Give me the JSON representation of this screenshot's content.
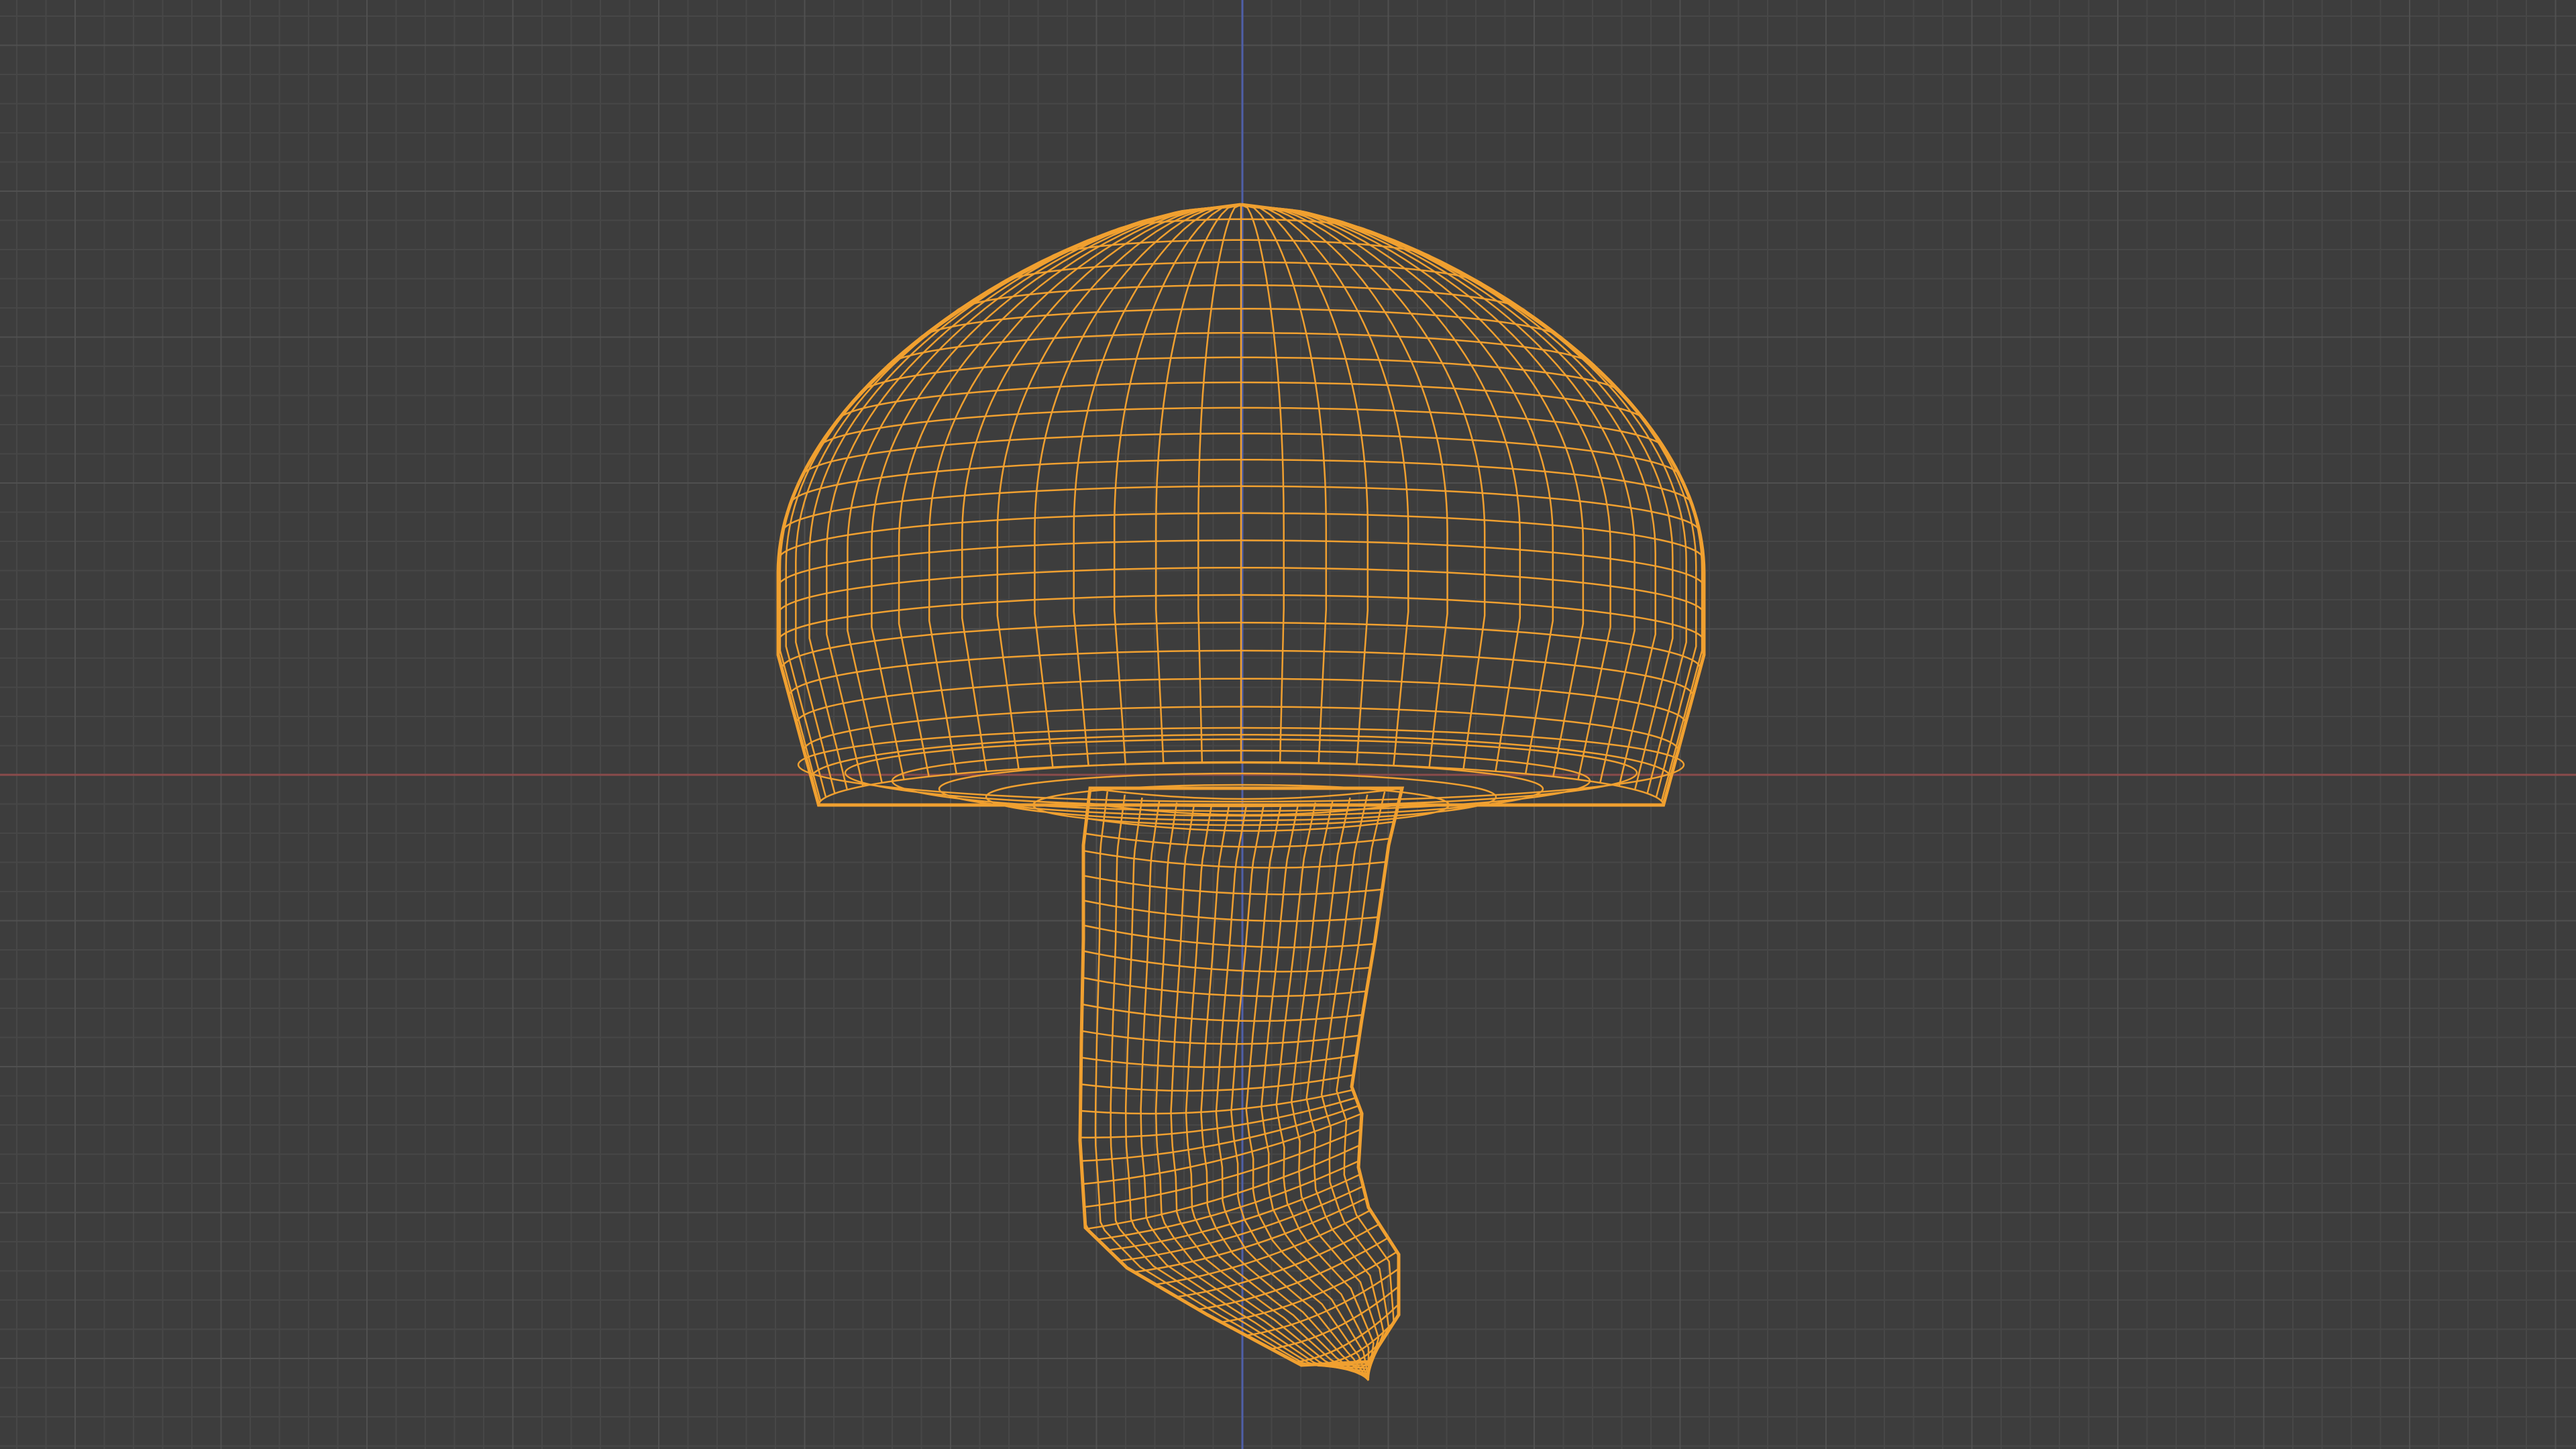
{
  "app": {
    "name": "",
    "view_mode": "wireframe"
  },
  "viewport": {
    "background_color": "#3d3d3d",
    "grid_enabled": true,
    "grid_minor_color": "#474747",
    "grid_major_color": "#505050",
    "axis_x_color": "#8a4b4b",
    "axis_z_color": "#4f5fa8"
  },
  "object": {
    "type": "mushroom",
    "selected": true,
    "wire_color": "#f0a030",
    "parts": [
      "cap",
      "gills",
      "stem",
      "stem-base"
    ]
  }
}
